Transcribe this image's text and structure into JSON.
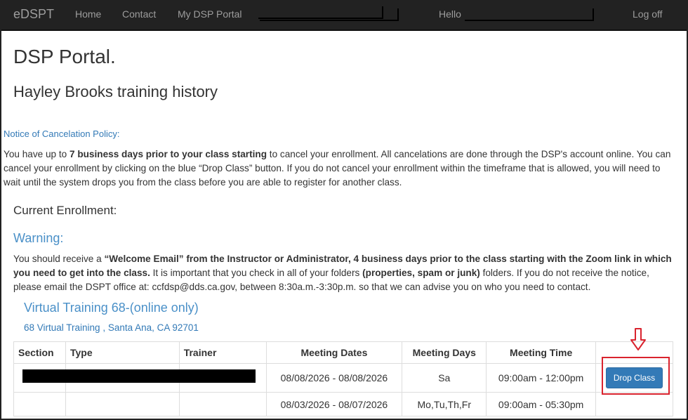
{
  "navbar": {
    "brand": "eDSPT",
    "links": [
      "Home",
      "Contact",
      "My DSP Portal"
    ],
    "hello": "Hello",
    "logoff": "Log off"
  },
  "page": {
    "title": "DSP Portal.",
    "subtitle": "Hayley Brooks training history"
  },
  "notice": {
    "title": "Notice of Cancelation Policy:",
    "p1": "You have up to ",
    "bold": "7 business days prior to your class starting",
    "p2": " to cancel your enrollment. All cancelations are done through the DSP's account online. You can cancel your enrollment by clicking on the blue “Drop Class” button. If you do not cancel your enrollment within the timeframe that is allowed, you will need to wait until the system drops you from the class before you are able to register for another class."
  },
  "current_enrollment": "Current Enrollment:",
  "warning": {
    "title": "Warning:",
    "p1": "You should receive a ",
    "b1": "“Welcome Email” from the Instructor or Administrator, 4 business days prior to the class starting with the Zoom link in which you need to get into the class.",
    "p2": " It is important that you check in all of your folders ",
    "b2": "(properties, spam or junk)",
    "p3": " folders. If you do not receive the notice, please email the DSPT office at: ccfdsp@dds.ca.gov, between 8:30a.m.-3:30p.m. so that we can advise you on who you need to contact."
  },
  "training": {
    "title": "Virtual Training 68-(online only)",
    "address": "68 Virtual Training , Santa Ana, CA 92701"
  },
  "table": {
    "headers": [
      "Section",
      "Type",
      "Trainer",
      "Meeting Dates",
      "Meeting Days",
      "Meeting Time"
    ],
    "rows": [
      {
        "dates": "08/08/2026 - 08/08/2026",
        "days": "Sa",
        "time": "09:00am - 12:00pm"
      },
      {
        "dates": "08/03/2026 - 08/07/2026",
        "days": "Mo,Tu,Th,Fr",
        "time": "09:00am - 05:30pm"
      }
    ],
    "drop_button": "Drop Class"
  },
  "colors": {
    "navbar": "#222222",
    "link": "#337ab7",
    "button": "#337ab7",
    "highlight": "#d9232e"
  }
}
